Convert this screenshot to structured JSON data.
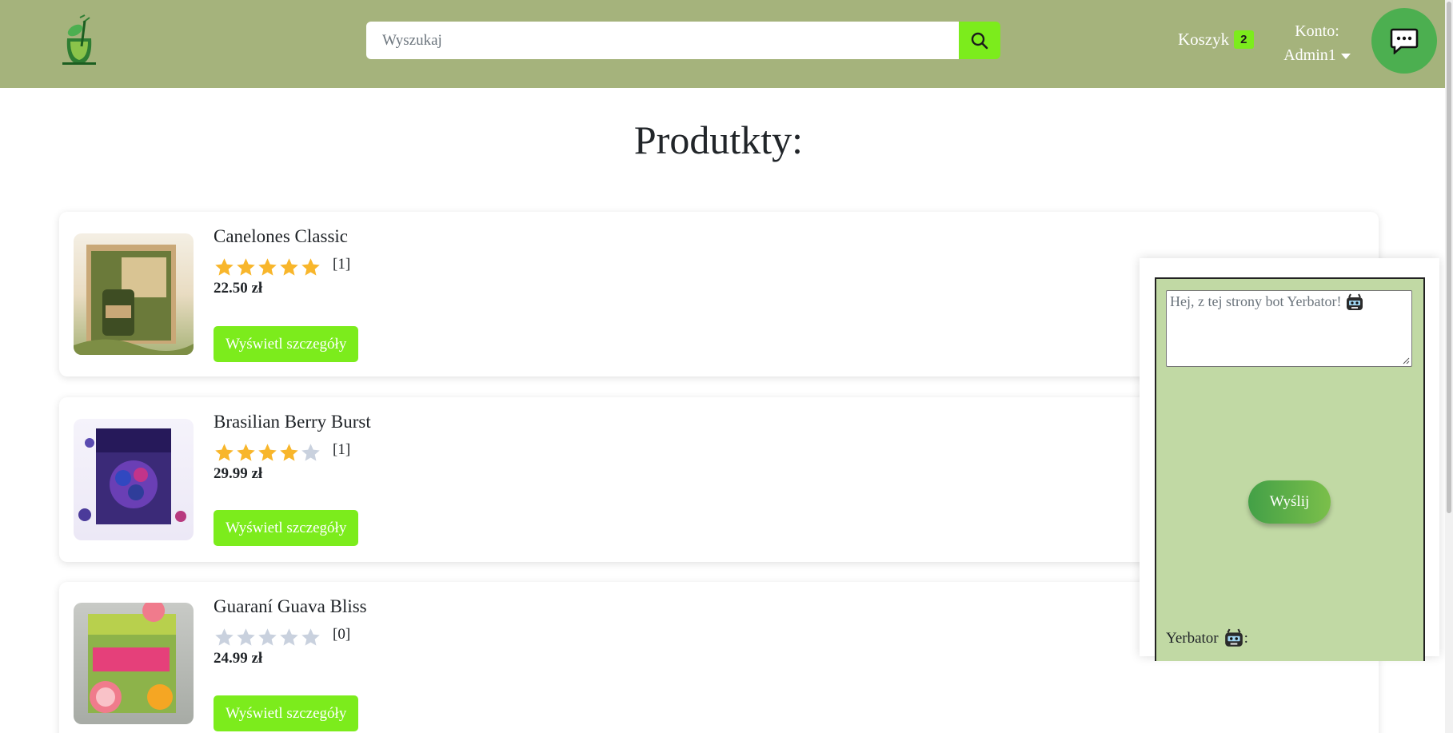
{
  "header": {
    "search": {
      "placeholder": "Wyszukaj",
      "value": ""
    },
    "cart": {
      "label": "Koszyk",
      "count": "2"
    },
    "account": {
      "label": "Konto:",
      "user": "Admin1"
    }
  },
  "main": {
    "title": "Produtkty:",
    "products": [
      {
        "name": "Canelones Classic",
        "rating": 5,
        "reviews": "[1]",
        "price": "22.50 zł",
        "button": "Wyświetl szczegóły"
      },
      {
        "name": "Brasilian Berry Burst",
        "rating": 4,
        "reviews": "[1]",
        "price": "29.99 zł",
        "button": "Wyświetl szczegóły"
      },
      {
        "name": "Guaraní Guava Bliss",
        "rating": 0,
        "reviews": "[0]",
        "price": "24.99 zł",
        "button": "Wyświetl szczegóły"
      }
    ]
  },
  "chatbot": {
    "message": "Hej, z tej strony bot Yerbator!",
    "send_label": "Wyślij",
    "bot_label": "Yerbator",
    "bot_suffix": ":"
  },
  "colors": {
    "navbar": "#a5b37c",
    "accent": "#7cec1c",
    "chat_button": "#4caf50",
    "chat_panel": "#c1d9a4",
    "star_filled": "#f8b62b",
    "star_empty": "#c9d1de"
  },
  "icons": {
    "logo": "yerba-mate-logo-icon",
    "search": "search-icon",
    "chat": "chat-bubble-icon",
    "bot": "robot-face-icon"
  }
}
